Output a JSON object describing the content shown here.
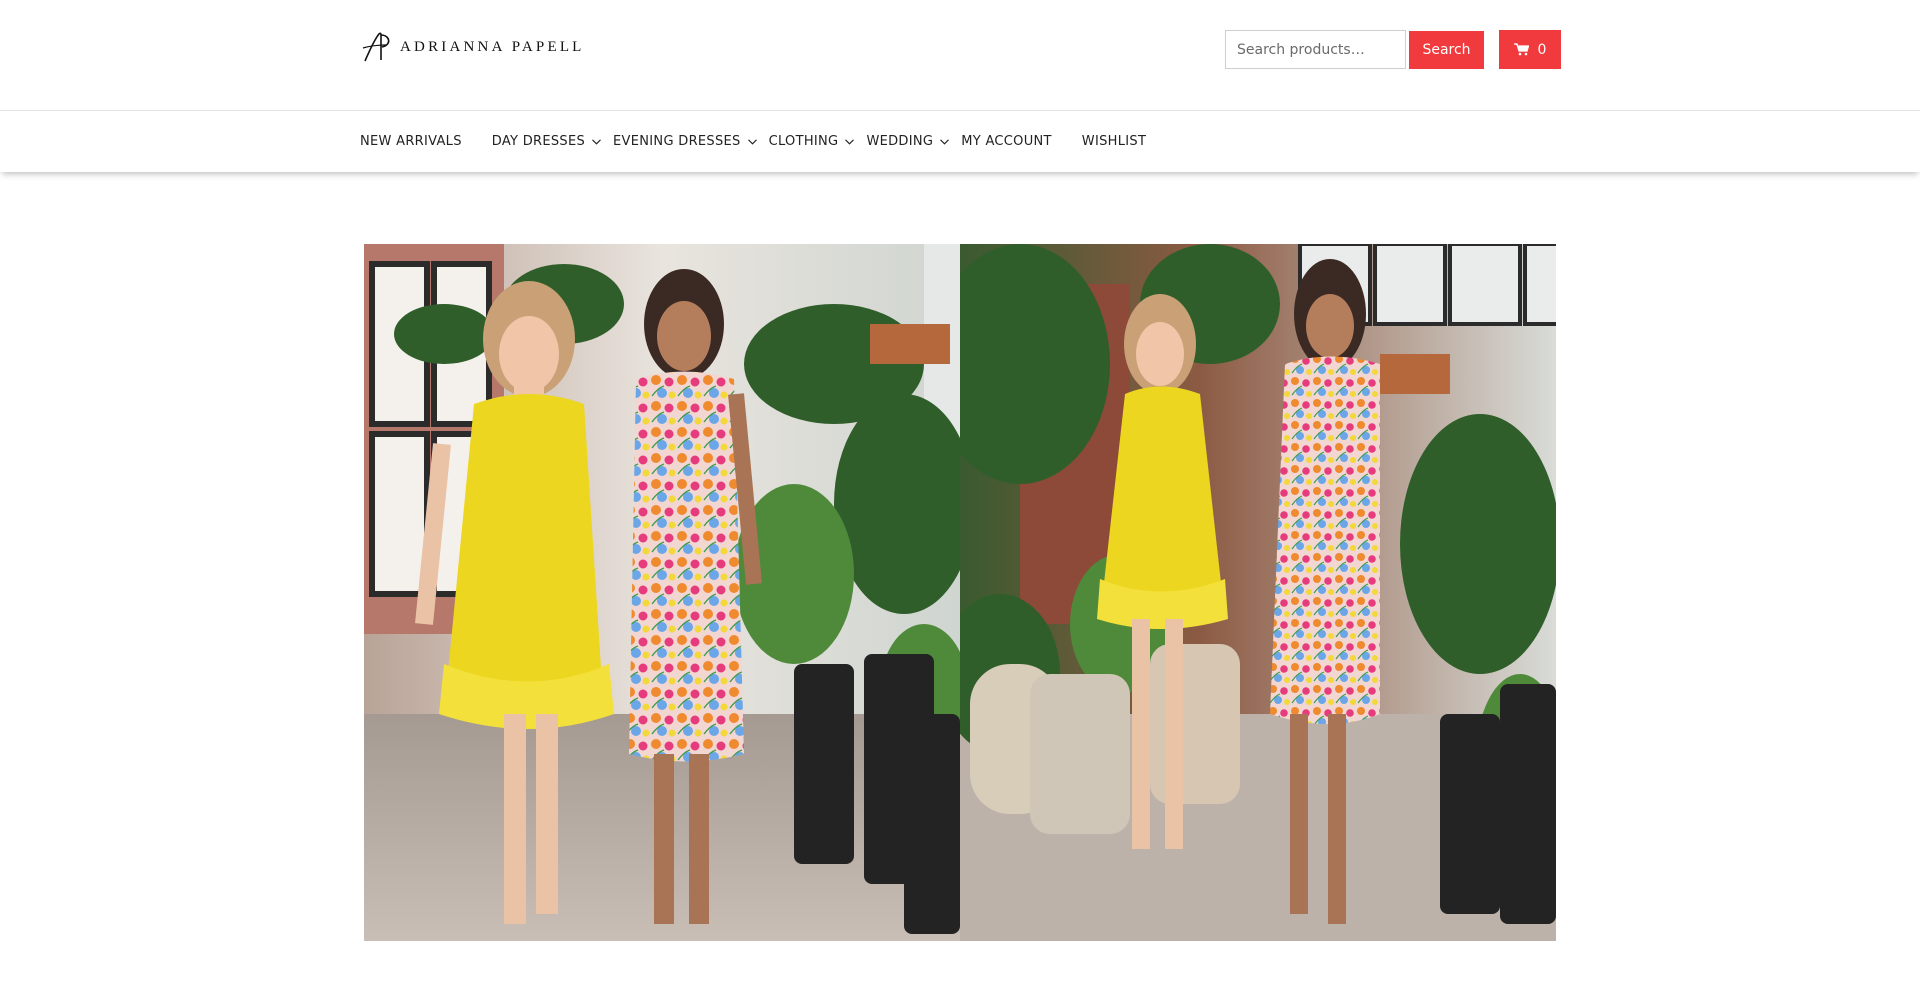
{
  "brand": {
    "name": "Adrianna Papell",
    "logo_text": "ADRIANNA PAPELL",
    "logo_icon": "ap-monogram-logo"
  },
  "search": {
    "placeholder": "Search products…",
    "button_label": "Search"
  },
  "cart": {
    "icon": "cart-icon",
    "count": "0"
  },
  "nav": {
    "items": [
      {
        "label": "NEW ARRIVALS",
        "has_submenu": false
      },
      {
        "label": "DAY DRESSES",
        "has_submenu": true
      },
      {
        "label": "EVENING DRESSES",
        "has_submenu": true
      },
      {
        "label": "CLOTHING",
        "has_submenu": true
      },
      {
        "label": "WEDDING",
        "has_submenu": true
      },
      {
        "label": "MY ACCOUNT",
        "has_submenu": false
      },
      {
        "label": "WISHLIST",
        "has_submenu": false
      }
    ]
  },
  "colors": {
    "accent": "#f13a3e",
    "text": "#222222",
    "border": "#e2e2e2"
  }
}
